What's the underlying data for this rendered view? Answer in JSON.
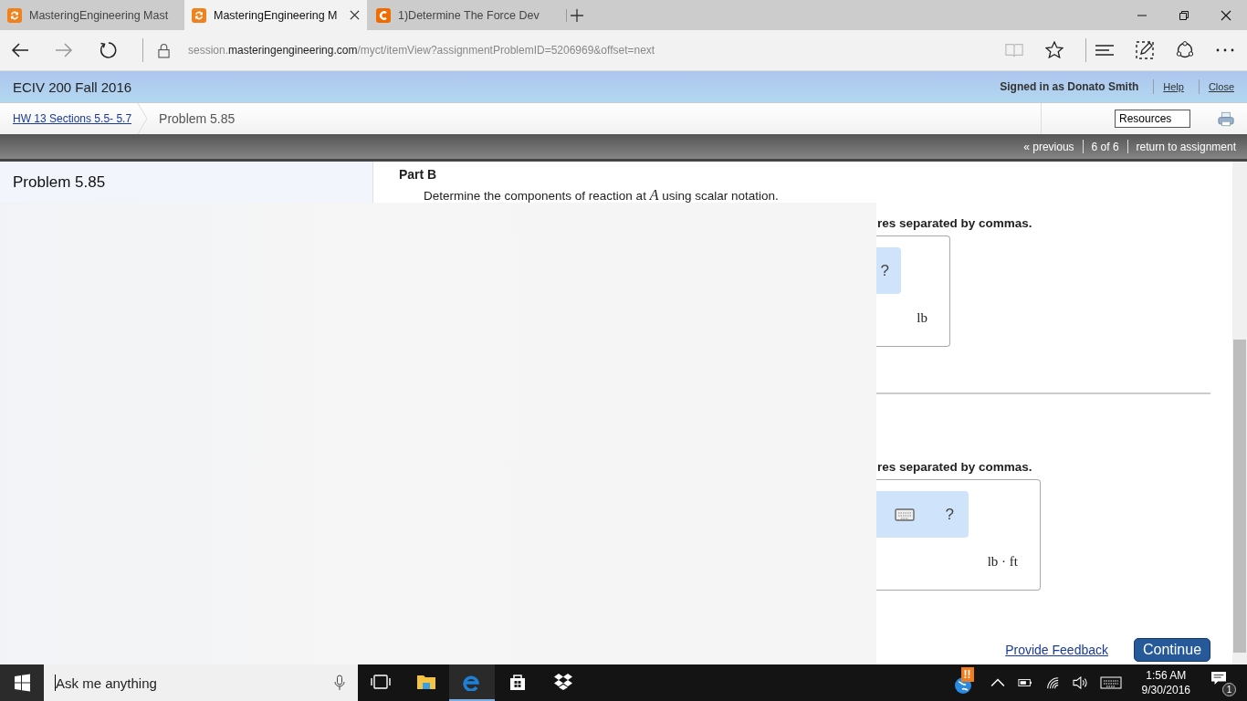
{
  "browser": {
    "tabs": [
      {
        "title": "MasteringEngineering Mast",
        "kind": "mastering",
        "selected": false
      },
      {
        "title": "MasteringEngineering M",
        "kind": "mastering",
        "selected": true
      },
      {
        "title": "1)Determine The Force Dev",
        "kind": "chegg",
        "selected": false
      }
    ],
    "address": {
      "prefix": "session.",
      "domain": "masteringengineering.com",
      "path": "/myct/itemView?assignmentProblemID=5206969&offset=next"
    }
  },
  "course_header": {
    "course": "ECIV 200 Fall 2016",
    "signed_in": "Signed in as Donato Smith",
    "links": [
      "Help",
      "Close"
    ]
  },
  "breadcrumb": {
    "link": "HW 13 Sections 5.5- 5.7",
    "current": "Problem 5.85",
    "resources": "Resources"
  },
  "nav": {
    "previous": "« previous",
    "position": "6 of 6",
    "return": "return to assignment"
  },
  "sidebar": {
    "title": "Problem 5.85"
  },
  "parts": [
    {
      "title": "Part B",
      "question": "Determine the components of reaction at *A* using scalar notation.",
      "instruction": "res separated by commas.",
      "help": "?",
      "unit": "lb"
    },
    {
      "instruction": "res separated by commas.",
      "help": "?",
      "keyboard": true,
      "unit": "lb · ft"
    }
  ],
  "footer": {
    "feedback": "Provide Feedback",
    "continue": "Continue"
  },
  "taskbar": {
    "search_placeholder": "Ask me anything",
    "apps": [
      {
        "kind": "taskview",
        "active": false
      },
      {
        "kind": "folder",
        "active": false
      },
      {
        "kind": "edge",
        "active": true
      },
      {
        "kind": "store",
        "active": false
      },
      {
        "kind": "dropbox",
        "active": false
      }
    ],
    "alert": "!!",
    "time": "1:56 AM",
    "date": "9/30/2016",
    "notifications": "1"
  }
}
